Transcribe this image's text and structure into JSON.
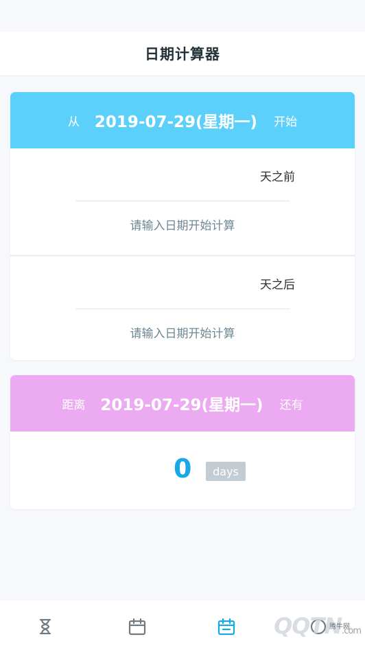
{
  "app": {
    "title": "日期计算器"
  },
  "start_card": {
    "prefix": "从",
    "date": "2019-07-29(星期一)",
    "suffix": "开始",
    "before": {
      "unit": "天之前",
      "hint": "请输入日期开始计算"
    },
    "after": {
      "unit": "天之后",
      "hint": "请输入日期开始计算"
    },
    "header_color": "#5bd0fb"
  },
  "countdown_card": {
    "prefix": "距离",
    "date": "2019-07-29(星期一)",
    "suffix": "还有",
    "value": "0",
    "unit": "days",
    "header_color": "#ebaaf2"
  },
  "tabbar": {
    "items": [
      {
        "icon": "hourglass-icon"
      },
      {
        "icon": "calendar-icon"
      },
      {
        "icon": "calendar-calc-icon",
        "active": true
      },
      {
        "icon": "other-icon"
      }
    ]
  },
  "watermark": {
    "text": "QQTN",
    "suffix": ".com",
    "tag": "腾牛网"
  }
}
